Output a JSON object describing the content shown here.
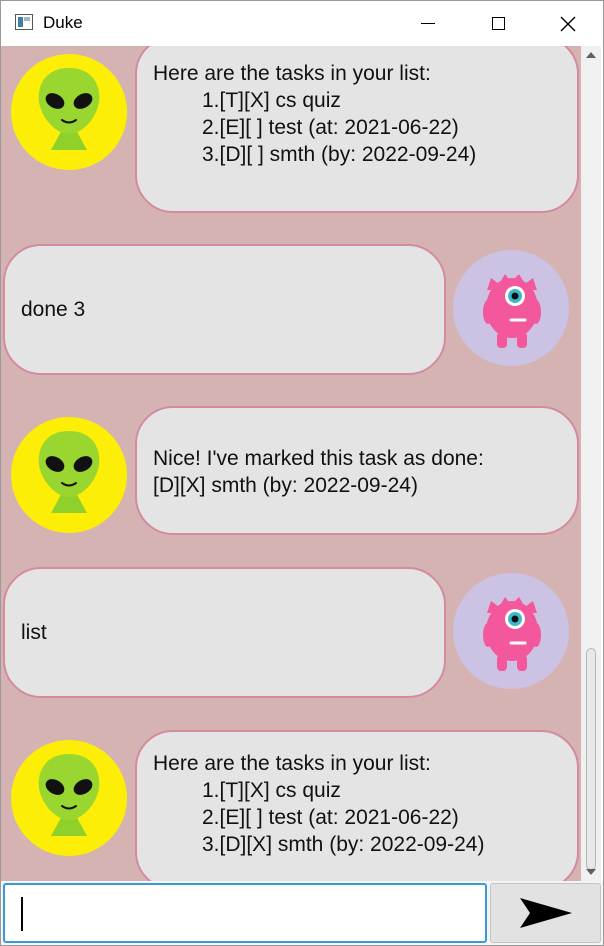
{
  "window": {
    "title": "Duke"
  },
  "titlebar": {
    "minimize": "minimize-icon",
    "maximize": "maximize-icon",
    "close": "close-icon"
  },
  "messages": [
    {
      "sender": "duke",
      "lines": [
        "Here are the tasks in your list:",
        "1.[T][X] cs quiz",
        "2.[E][ ] test (at: 2021-06-22)",
        "3.[D][ ] smth (by: 2022-09-24)"
      ]
    },
    {
      "sender": "user",
      "lines": [
        "done 3"
      ]
    },
    {
      "sender": "duke",
      "lines": [
        "Nice! I've marked this task as done:",
        "[D][X] smth (by: 2022-09-24)"
      ]
    },
    {
      "sender": "user",
      "lines": [
        "list"
      ]
    },
    {
      "sender": "duke",
      "lines": [
        "Here are the tasks in your list:",
        "1.[T][X] cs quiz",
        "2.[E][ ] test (at: 2021-06-22)",
        "3.[D][X] smth (by: 2022-09-24)"
      ]
    }
  ],
  "input": {
    "value": "",
    "placeholder": ""
  },
  "send": {
    "icon": "send-arrow-icon"
  },
  "colors": {
    "chat_background": "#d5b3b3",
    "bubble_fill": "#e4e4e4",
    "bubble_border": "#d48aa0",
    "duke_avatar_bg": "#fcee06",
    "user_avatar_bg": "#cbc2e4",
    "input_focus": "#3a9ad9"
  }
}
